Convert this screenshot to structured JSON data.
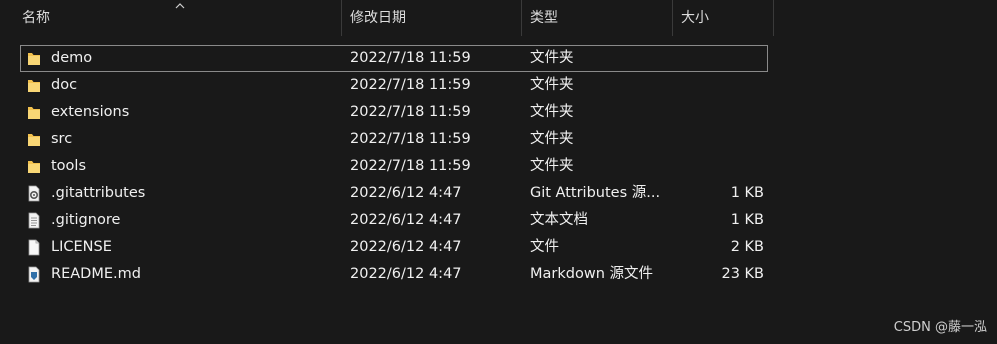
{
  "columns": {
    "name": "名称",
    "date": "修改日期",
    "type": "类型",
    "size": "大小"
  },
  "rows": [
    {
      "icon": "folder-icon",
      "name": "demo",
      "date": "2022/7/18 11:59",
      "type": "文件夹",
      "size": ""
    },
    {
      "icon": "folder-icon",
      "name": "doc",
      "date": "2022/7/18 11:59",
      "type": "文件夹",
      "size": ""
    },
    {
      "icon": "folder-icon",
      "name": "extensions",
      "date": "2022/7/18 11:59",
      "type": "文件夹",
      "size": ""
    },
    {
      "icon": "folder-icon",
      "name": "src",
      "date": "2022/7/18 11:59",
      "type": "文件夹",
      "size": ""
    },
    {
      "icon": "folder-icon",
      "name": "tools",
      "date": "2022/7/18 11:59",
      "type": "文件夹",
      "size": ""
    },
    {
      "icon": "settings-file-icon",
      "name": ".gitattributes",
      "date": "2022/6/12 4:47",
      "type": "Git Attributes 源...",
      "size": "1 KB"
    },
    {
      "icon": "text-file-icon",
      "name": ".gitignore",
      "date": "2022/6/12 4:47",
      "type": "文本文档",
      "size": "1 KB"
    },
    {
      "icon": "blank-file-icon",
      "name": "LICENSE",
      "date": "2022/6/12 4:47",
      "type": "文件",
      "size": "2 KB"
    },
    {
      "icon": "markdown-file-icon",
      "name": "README.md",
      "date": "2022/6/12 4:47",
      "type": "Markdown 源文件",
      "size": "23 KB"
    }
  ],
  "watermark": "CSDN @藤一泓"
}
